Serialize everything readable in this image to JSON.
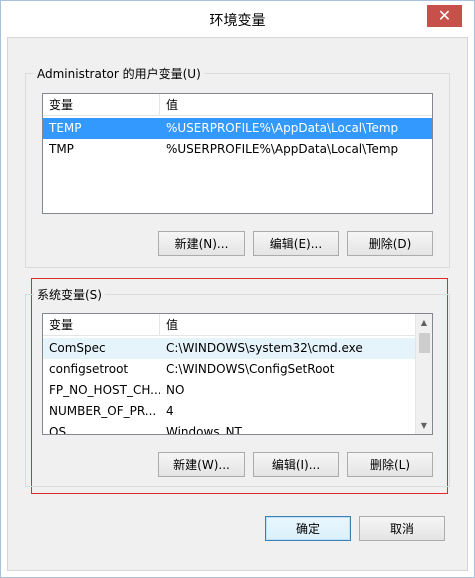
{
  "window": {
    "title": "环境变量",
    "close_glyph": "✕"
  },
  "user_vars": {
    "group_label": "Administrator 的用户变量(U)",
    "columns": [
      "变量",
      "值"
    ],
    "rows": [
      {
        "name": "TEMP",
        "value": "%USERPROFILE%\\AppData\\Local\\Temp",
        "selected": true
      },
      {
        "name": "TMP",
        "value": "%USERPROFILE%\\AppData\\Local\\Temp",
        "selected": false
      }
    ],
    "buttons": {
      "new": "新建(N)...",
      "edit": "编辑(E)...",
      "delete": "删除(D)"
    }
  },
  "system_vars": {
    "group_label": "系统变量(S)",
    "columns": [
      "变量",
      "值"
    ],
    "rows": [
      {
        "name": "ComSpec",
        "value": "C:\\WINDOWS\\system32\\cmd.exe"
      },
      {
        "name": "configsetroot",
        "value": "C:\\WINDOWS\\ConfigSetRoot"
      },
      {
        "name": "FP_NO_HOST_CH...",
        "value": "NO"
      },
      {
        "name": "NUMBER_OF_PR...",
        "value": "4"
      },
      {
        "name": "OS",
        "value": "Windows_NT"
      }
    ],
    "buttons": {
      "new": "新建(W)...",
      "edit": "编辑(I)...",
      "delete": "删除(L)"
    },
    "scroll_up_glyph": "▲",
    "scroll_down_glyph": "▼"
  },
  "footer": {
    "ok": "确定",
    "cancel": "取消"
  },
  "colors": {
    "selection": "#3399ff",
    "highlight_outline": "#e02a2a",
    "close_button": "#c7504a"
  }
}
